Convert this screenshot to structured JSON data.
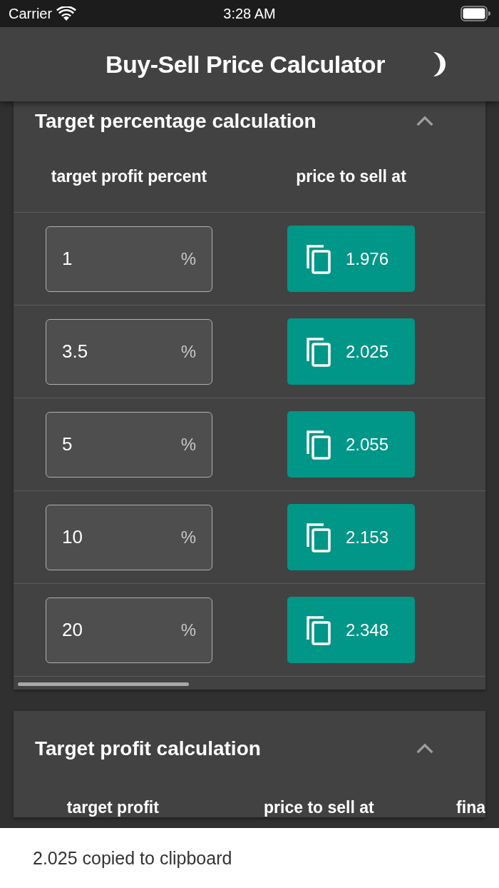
{
  "status_bar": {
    "carrier": "Carrier",
    "time": "3:28 AM"
  },
  "app_bar": {
    "title": "Buy-Sell Price Calculator"
  },
  "sections": [
    {
      "title": "Target percentage calculation",
      "expanded": true,
      "columns": [
        "target profit percent",
        "price to sell at"
      ],
      "rows": [
        {
          "percent": "1",
          "unit": "%",
          "price": "1.976"
        },
        {
          "percent": "3.5",
          "unit": "%",
          "price": "2.025"
        },
        {
          "percent": "5",
          "unit": "%",
          "price": "2.055"
        },
        {
          "percent": "10",
          "unit": "%",
          "price": "2.153"
        },
        {
          "percent": "20",
          "unit": "%",
          "price": "2.348"
        }
      ]
    },
    {
      "title": "Target profit calculation",
      "expanded": true,
      "columns": [
        "target profit",
        "price to sell at",
        "fina"
      ]
    }
  ],
  "snackbar": {
    "message": "2.025 copied to clipboard"
  }
}
